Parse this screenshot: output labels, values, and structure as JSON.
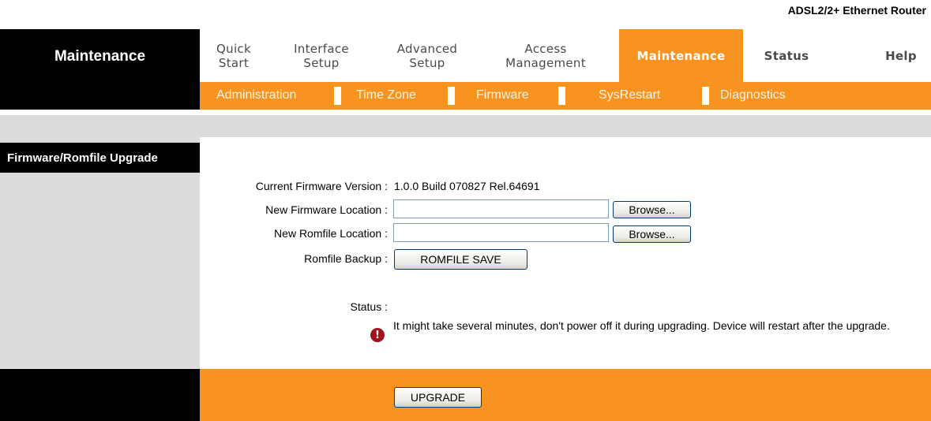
{
  "product_name": "ADSL2/2+ Ethernet Router",
  "header": {
    "title": "Maintenance",
    "nav": [
      {
        "line1": "Quick",
        "line2": "Start"
      },
      {
        "line1": "Interface",
        "line2": "Setup"
      },
      {
        "line1": "Advanced",
        "line2": "Setup"
      },
      {
        "line1": "Access",
        "line2": "Management"
      },
      {
        "line1": "Maintenance",
        "line2": ""
      },
      {
        "line1": "Status",
        "line2": ""
      },
      {
        "line1": "Help",
        "line2": ""
      }
    ],
    "active_nav": "Maintenance"
  },
  "subnav": [
    "Administration",
    "Time Zone",
    "Firmware",
    "SysRestart",
    "Diagnostics"
  ],
  "section": {
    "title": "Firmware/Romfile Upgrade"
  },
  "form": {
    "current_fw_label": "Current Firmware Version :",
    "current_fw_value": "1.0.0 Build 070827 Rel.64691",
    "new_fw_label": "New Firmware Location :",
    "new_fw_value": "",
    "new_rom_label": "New Romfile Location :",
    "new_rom_value": "",
    "browse_label": "Browse...",
    "backup_label": "Romfile Backup :",
    "backup_button": "ROMFILE SAVE",
    "status_label": "Status :",
    "status_message": "It might take several minutes, don't power off it during upgrading. Device will restart after the upgrade."
  },
  "footer": {
    "upgrade_button": "UPGRADE"
  },
  "colors": {
    "accent": "#f7931e",
    "dark": "#000000",
    "panel_gray": "#dcdcdc",
    "warning": "#a0121c"
  },
  "icons": {
    "warning": "exclamation-circle-icon"
  }
}
